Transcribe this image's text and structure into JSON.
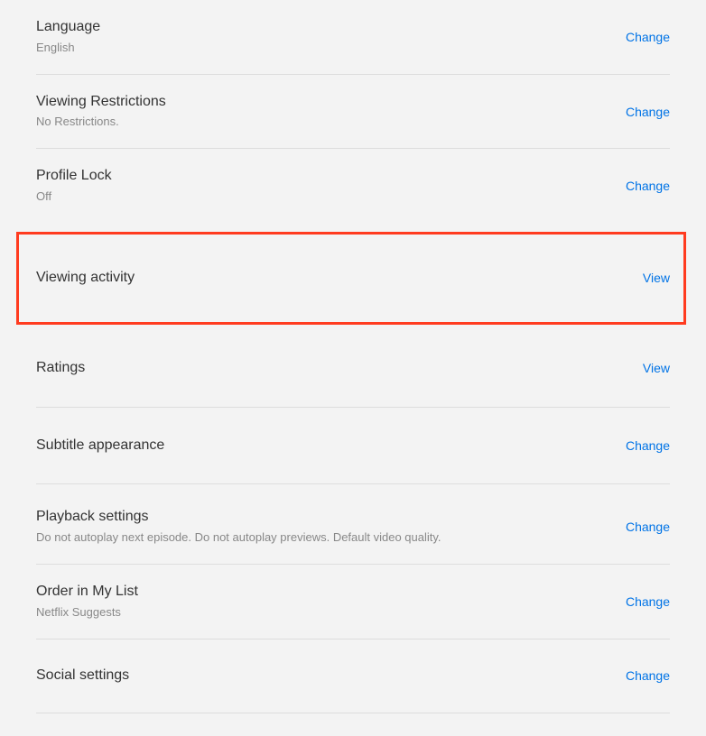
{
  "settings": [
    {
      "title": "Language",
      "subtitle": "English",
      "action": "Change"
    },
    {
      "title": "Viewing Restrictions",
      "subtitle": "No Restrictions.",
      "action": "Change"
    },
    {
      "title": "Profile Lock",
      "subtitle": "Off",
      "action": "Change"
    },
    {
      "title": "Viewing activity",
      "subtitle": "",
      "action": "View"
    },
    {
      "title": "Ratings",
      "subtitle": "",
      "action": "View"
    },
    {
      "title": "Subtitle appearance",
      "subtitle": "",
      "action": "Change"
    },
    {
      "title": "Playback settings",
      "subtitle": "Do not autoplay next episode. Do not autoplay previews. Default video quality.",
      "action": "Change"
    },
    {
      "title": "Order in My List",
      "subtitle": "Netflix Suggests",
      "action": "Change"
    },
    {
      "title": "Social settings",
      "subtitle": "",
      "action": "Change"
    }
  ]
}
